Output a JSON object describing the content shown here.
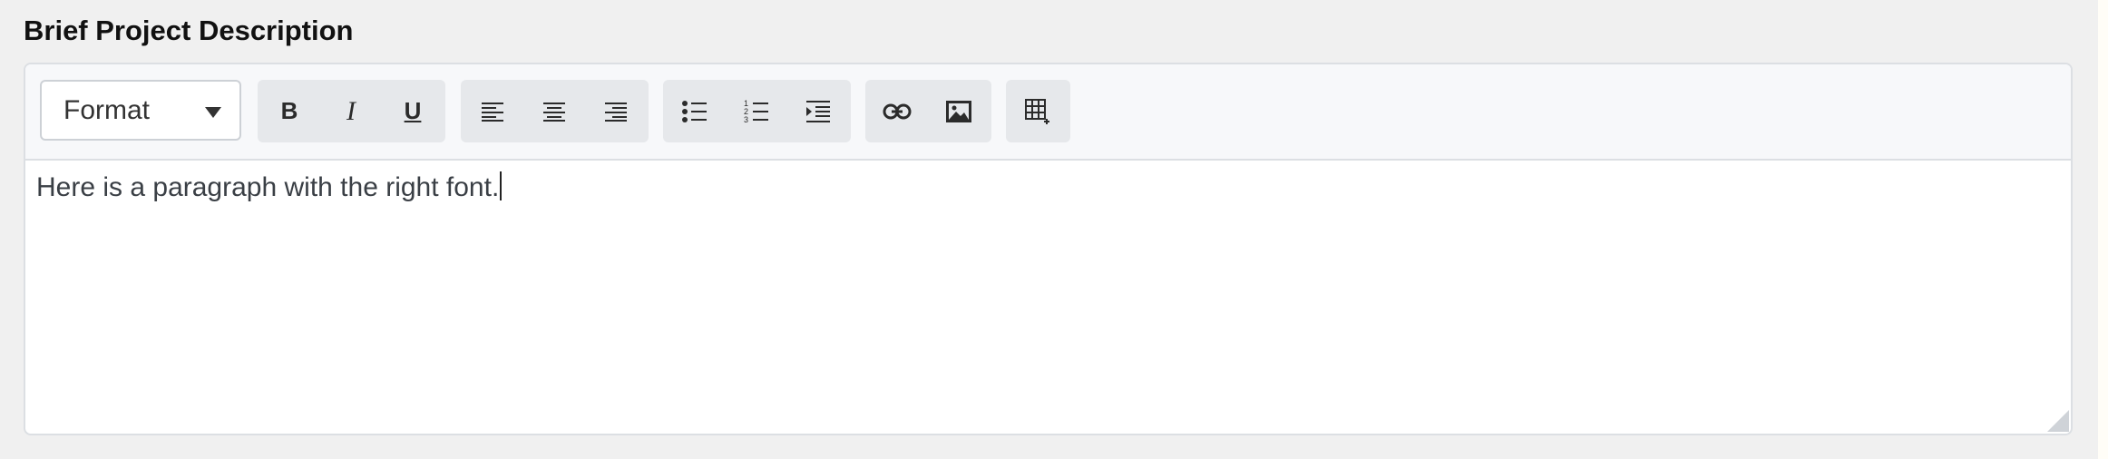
{
  "section": {
    "title": "Brief Project Description"
  },
  "toolbar": {
    "format_label": "Format",
    "bold_label": "B",
    "italic_label": "I",
    "underline_label": "U"
  },
  "editor": {
    "content": "Here is a paragraph with the right font."
  },
  "icons": [
    "chevron-down-icon",
    "align-left-icon",
    "align-center-icon",
    "align-right-icon",
    "bullet-list-icon",
    "numbered-list-icon",
    "indent-icon",
    "link-icon",
    "image-icon",
    "table-icon",
    "resize-handle-icon"
  ]
}
